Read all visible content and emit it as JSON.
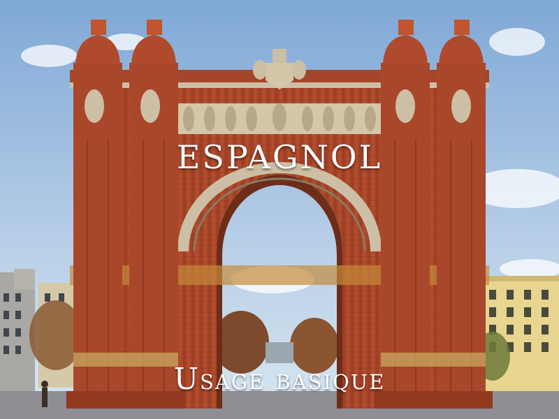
{
  "title": "ESPAGNOL",
  "subtitle": "Usage basique",
  "colors": {
    "sky_top": "#7fa8d6",
    "sky_bottom": "#d8e6f1",
    "brick": "#b24a2c",
    "brick_dark": "#8e3a22",
    "stone": "#cdbfa5",
    "road": "#8d8f94",
    "building_yellow": "#e8d58f"
  },
  "icons": {
    "scene": "triumphal-arch-photo"
  }
}
